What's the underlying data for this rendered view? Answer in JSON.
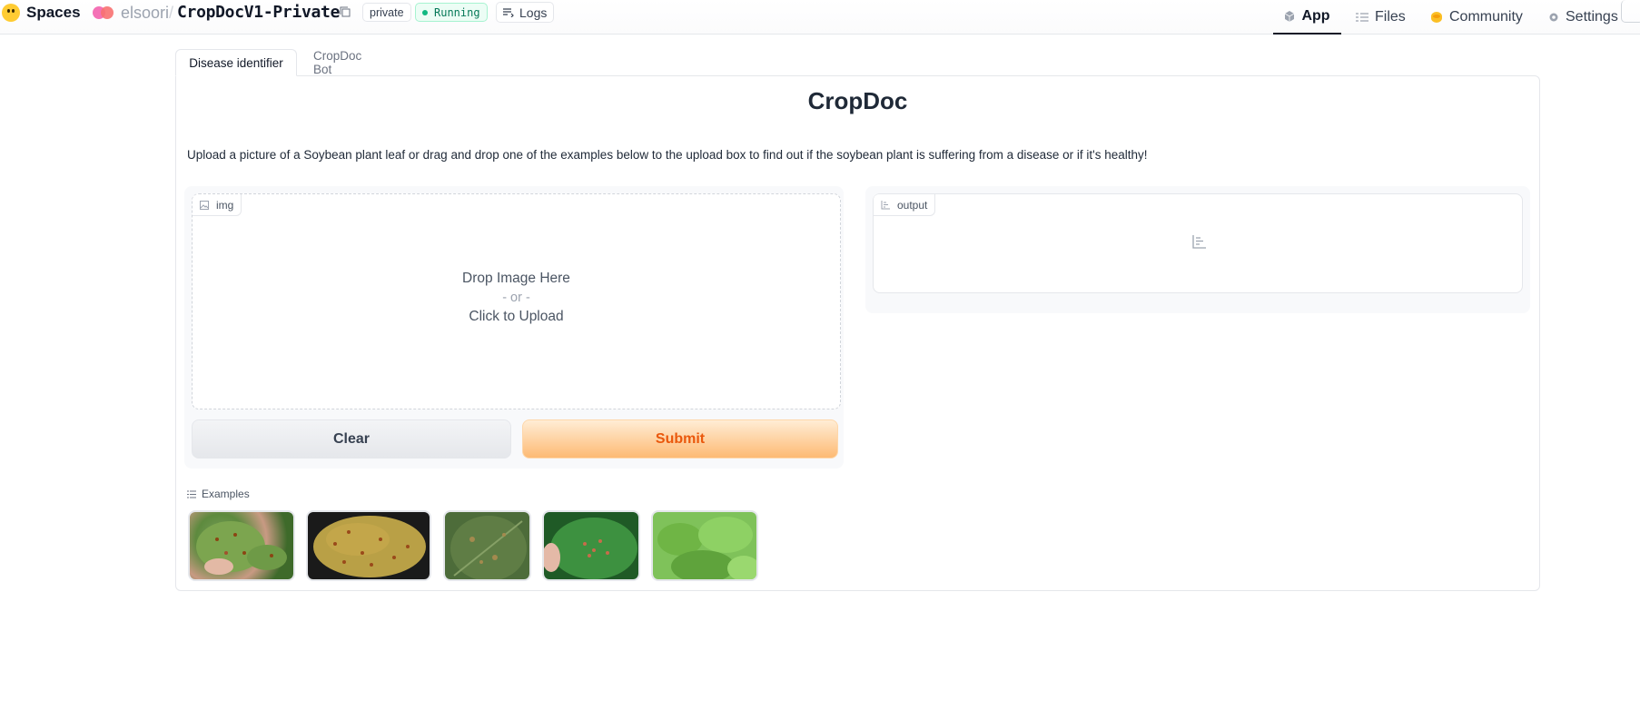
{
  "header": {
    "brand": "Spaces",
    "owner": "elsoori",
    "separator": "/",
    "repo": "CropDocV1-Private",
    "visibility_badge": "private",
    "status_badge": "Running",
    "logs_label": "Logs",
    "nav": [
      {
        "label": "App",
        "icon": "cube-icon",
        "active": true
      },
      {
        "label": "Files",
        "icon": "files-icon",
        "active": false
      },
      {
        "label": "Community",
        "icon": "community-icon",
        "active": false
      },
      {
        "label": "Settings",
        "icon": "gear-icon",
        "active": false
      }
    ]
  },
  "tabs": [
    {
      "label": "Disease identifier",
      "active": true
    },
    {
      "label": "CropDoc Bot",
      "active": false
    }
  ],
  "main": {
    "title": "CropDoc",
    "description": "Upload a picture of a Soybean plant leaf or drag and drop one of the examples below to the upload box to find out if the soybean plant is suffering from a disease or if it's healthy!",
    "input": {
      "label": "img",
      "drop_line1": "Drop Image Here",
      "drop_or": "- or -",
      "drop_line2": "Click to Upload"
    },
    "output": {
      "label": "output"
    },
    "buttons": {
      "clear": "Clear",
      "submit": "Submit"
    },
    "examples": {
      "label": "Examples",
      "items": [
        "example-image-1",
        "example-image-2",
        "example-image-3",
        "example-image-4",
        "example-image-5"
      ]
    }
  },
  "colors": {
    "accent": "#ea580c",
    "running": "#10b981",
    "border": "#e5e7eb"
  }
}
